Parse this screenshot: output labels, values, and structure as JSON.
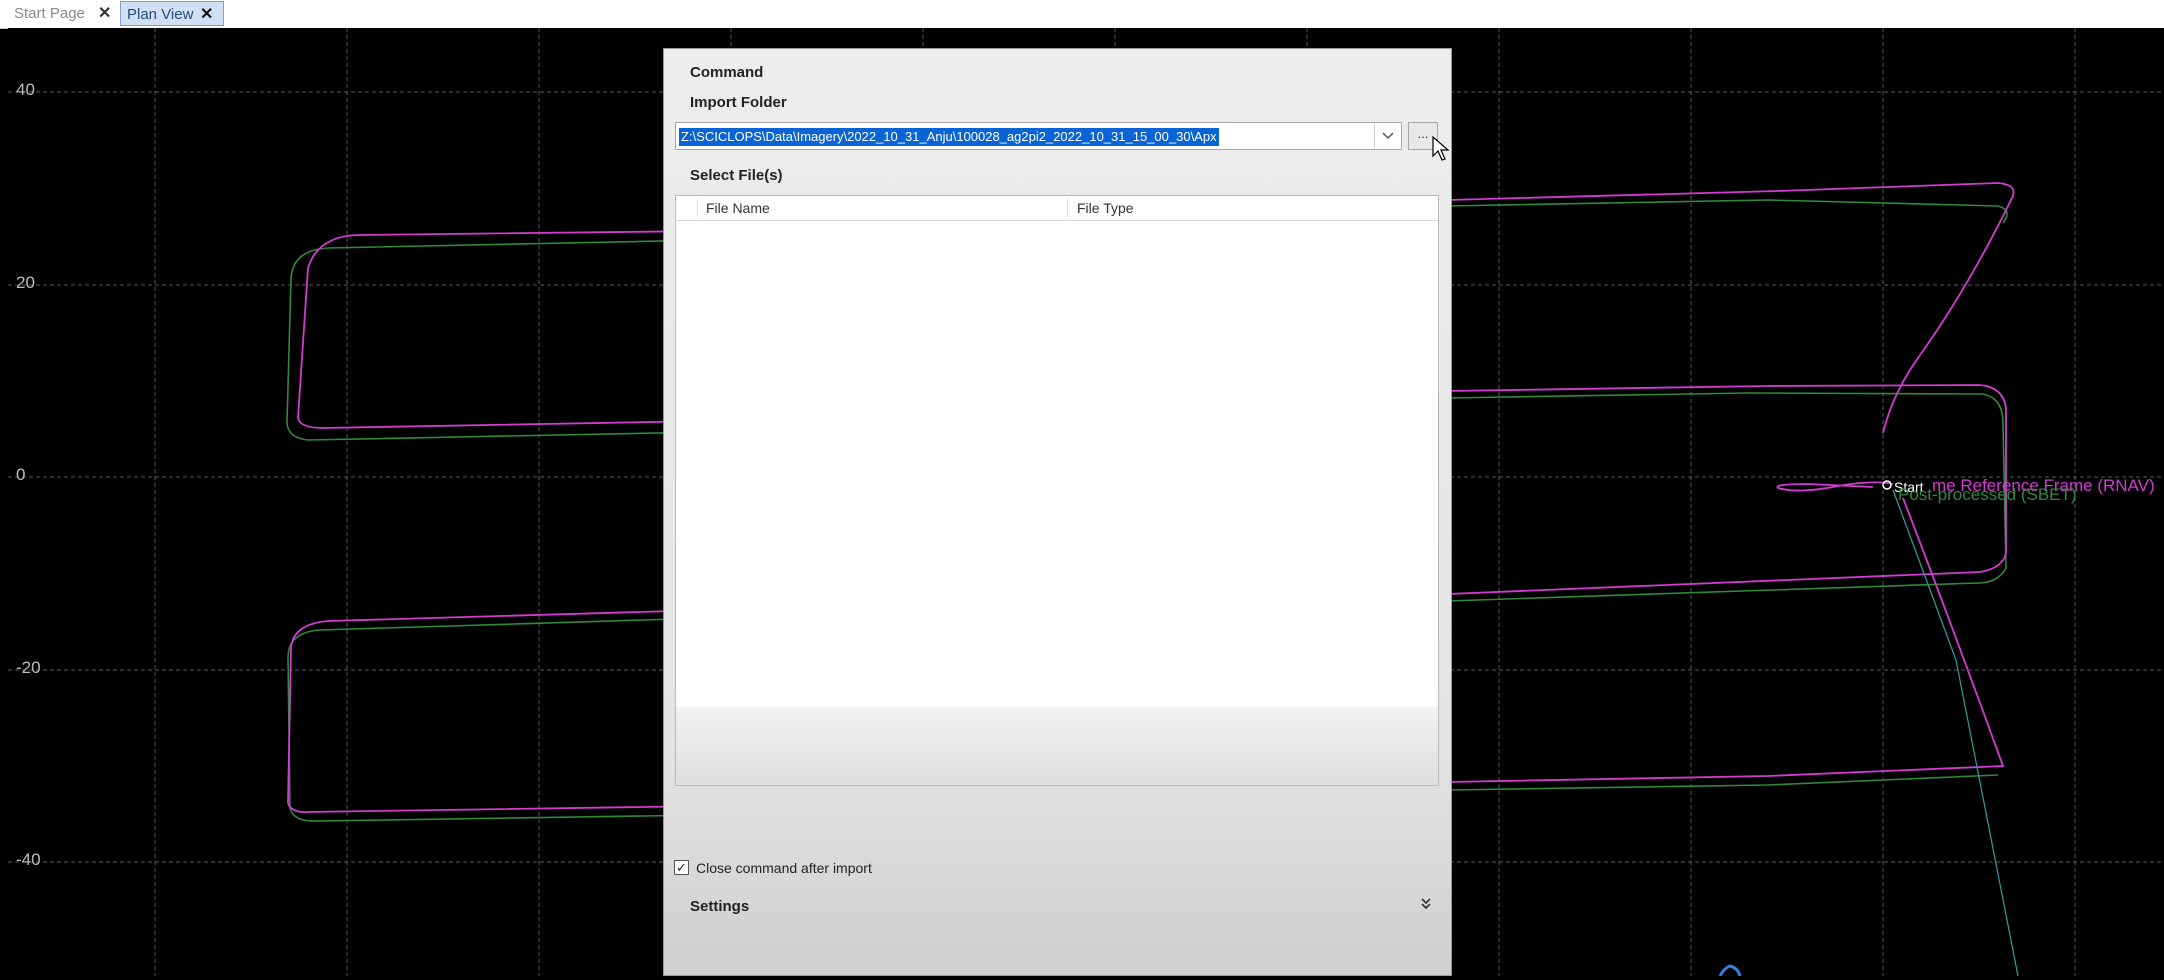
{
  "tabs": [
    {
      "label": "Start Page",
      "close": "✕",
      "active": false
    },
    {
      "label": "Plan View",
      "close": "✕",
      "active": true
    }
  ],
  "plot": {
    "y_ticks": [
      "40",
      "20",
      "0",
      "-20",
      "-40"
    ],
    "annotations": {
      "start": "Start",
      "rnav": "me Reference Frame (RNAV)",
      "sbet": "Post-processed (SBET)"
    },
    "colors": {
      "rnav": "#d23cd2",
      "sbet": "#2f8a3a",
      "grid": "#5a5a5a",
      "heading": "#2fa0a0"
    },
    "grid": true
  },
  "dialog": {
    "command_label": "Command",
    "import_folder_label": "Import Folder",
    "folder_value": "Z:\\SCICLOPS\\Data\\Imagery\\2022_10_31_Anju\\100028_ag2pi2_2022_10_31_15_00_30\\Apx",
    "browse_label": "...",
    "select_files_label": "Select File(s)",
    "columns": [
      "File Name",
      "File Type"
    ],
    "files": [],
    "close_after_import_label": "Close command after import",
    "close_after_import_checked": true,
    "settings_label": "Settings",
    "settings_icon": "chevron-double-down-icon"
  }
}
